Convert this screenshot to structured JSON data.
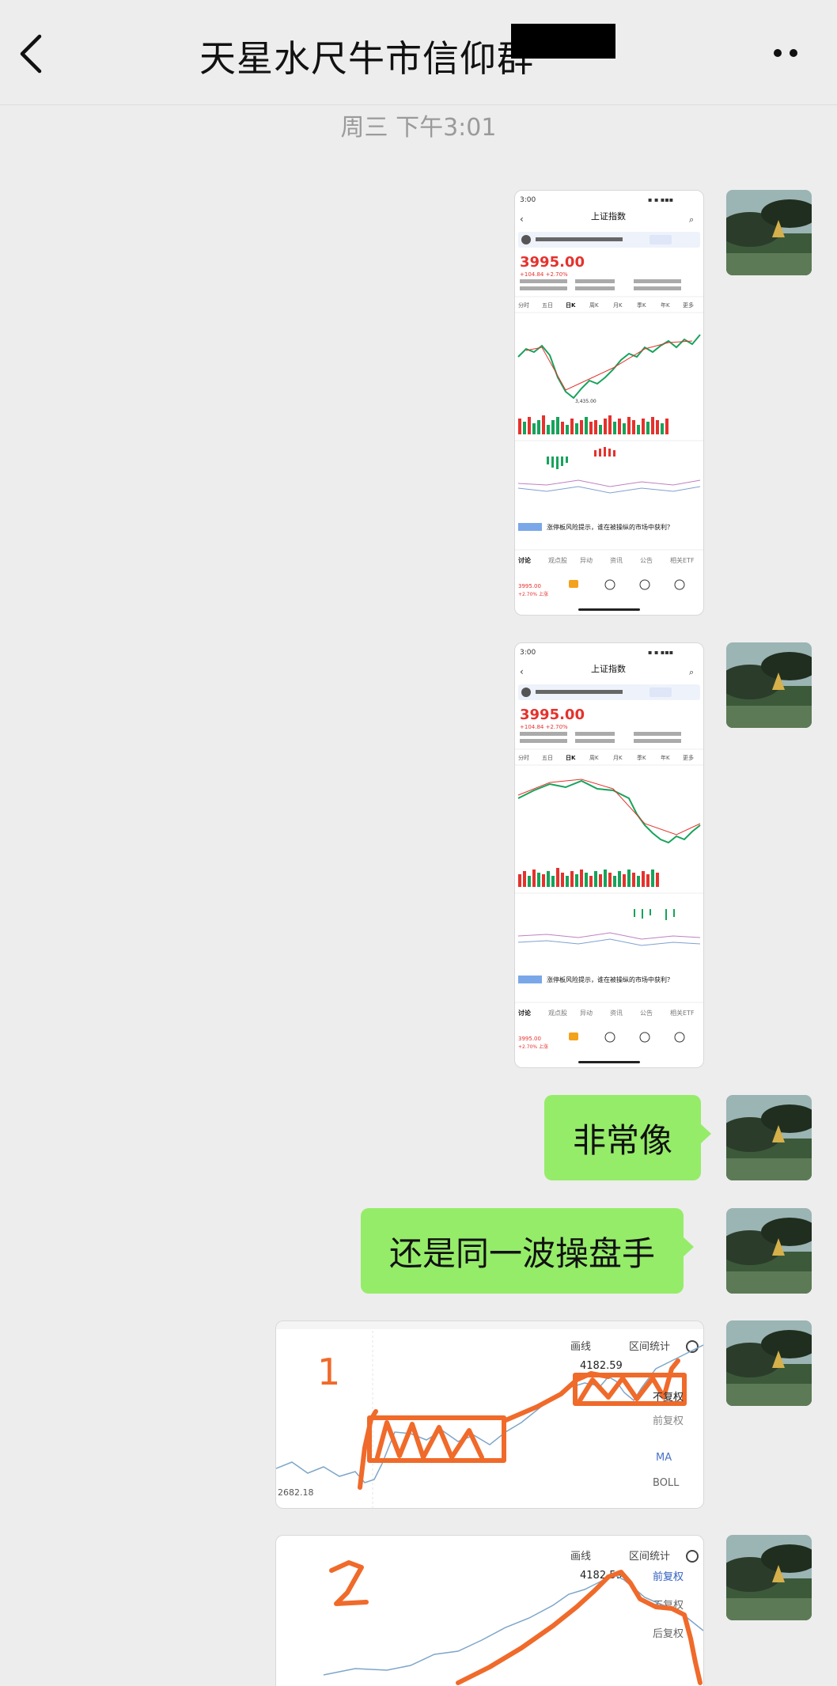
{
  "header": {
    "title": "天星水尺牛市信仰群"
  },
  "timestamp": "周三 下午3:01",
  "messages": [
    {
      "type": "image"
    },
    {
      "type": "image"
    },
    {
      "type": "text",
      "text": "非常像"
    },
    {
      "type": "text",
      "text": "还是同一波操盘手"
    },
    {
      "type": "image"
    },
    {
      "type": "image"
    }
  ],
  "screenshot1": {
    "status_time": "3:00",
    "title": "上证指数",
    "price": "3995.00",
    "change": "+104.84 +2.70%",
    "tabs": [
      "分时",
      "五日",
      "日K",
      "周K",
      "月K",
      "季K",
      "年K",
      "更多"
    ],
    "active_tab": "日K",
    "low_label": "3,435.00",
    "news": "涨停板风险提示，谁在被操纵的市场中获利？",
    "bottom_tabs": [
      "讨论",
      "观点股",
      "异动",
      "资讯",
      "公告",
      "相关ETF"
    ],
    "bottom_price": "3995.00",
    "bottom_change": "+2.70% 上涨"
  },
  "screenshot2": {
    "status_time": "3:00",
    "title": "上证指数",
    "price": "3995.00",
    "change": "+104.84 +2.70%",
    "tabs": [
      "分时",
      "五日",
      "日K",
      "周K",
      "月K",
      "季K",
      "年K",
      "更多"
    ],
    "active_tab": "日K",
    "news": "涨停板风险提示，谁在被操纵的市场中获利？",
    "bottom_tabs": [
      "讨论",
      "观点股",
      "异动",
      "资讯",
      "公告",
      "相关ETF"
    ],
    "bottom_price": "3995.00",
    "bottom_change": "+2.70% 上涨"
  },
  "chart1": {
    "annotation": "1",
    "toolbar": [
      "画线",
      "区间统计"
    ],
    "peak": "4182.59",
    "options": [
      "不复权",
      "前复权",
      "MA",
      "BOLL"
    ],
    "selected_option": "不复权",
    "corner": "2682.18"
  },
  "chart2": {
    "annotation": "2",
    "toolbar": [
      "画线",
      "区间统计"
    ],
    "peak": "4182.59",
    "options": [
      "前复权",
      "不复权",
      "后复权"
    ],
    "selected_option": "前复权"
  },
  "colors": {
    "bubble": "#95ec69",
    "red": "#e5322d",
    "green": "#16a35b",
    "orange": "#f06a2a"
  }
}
